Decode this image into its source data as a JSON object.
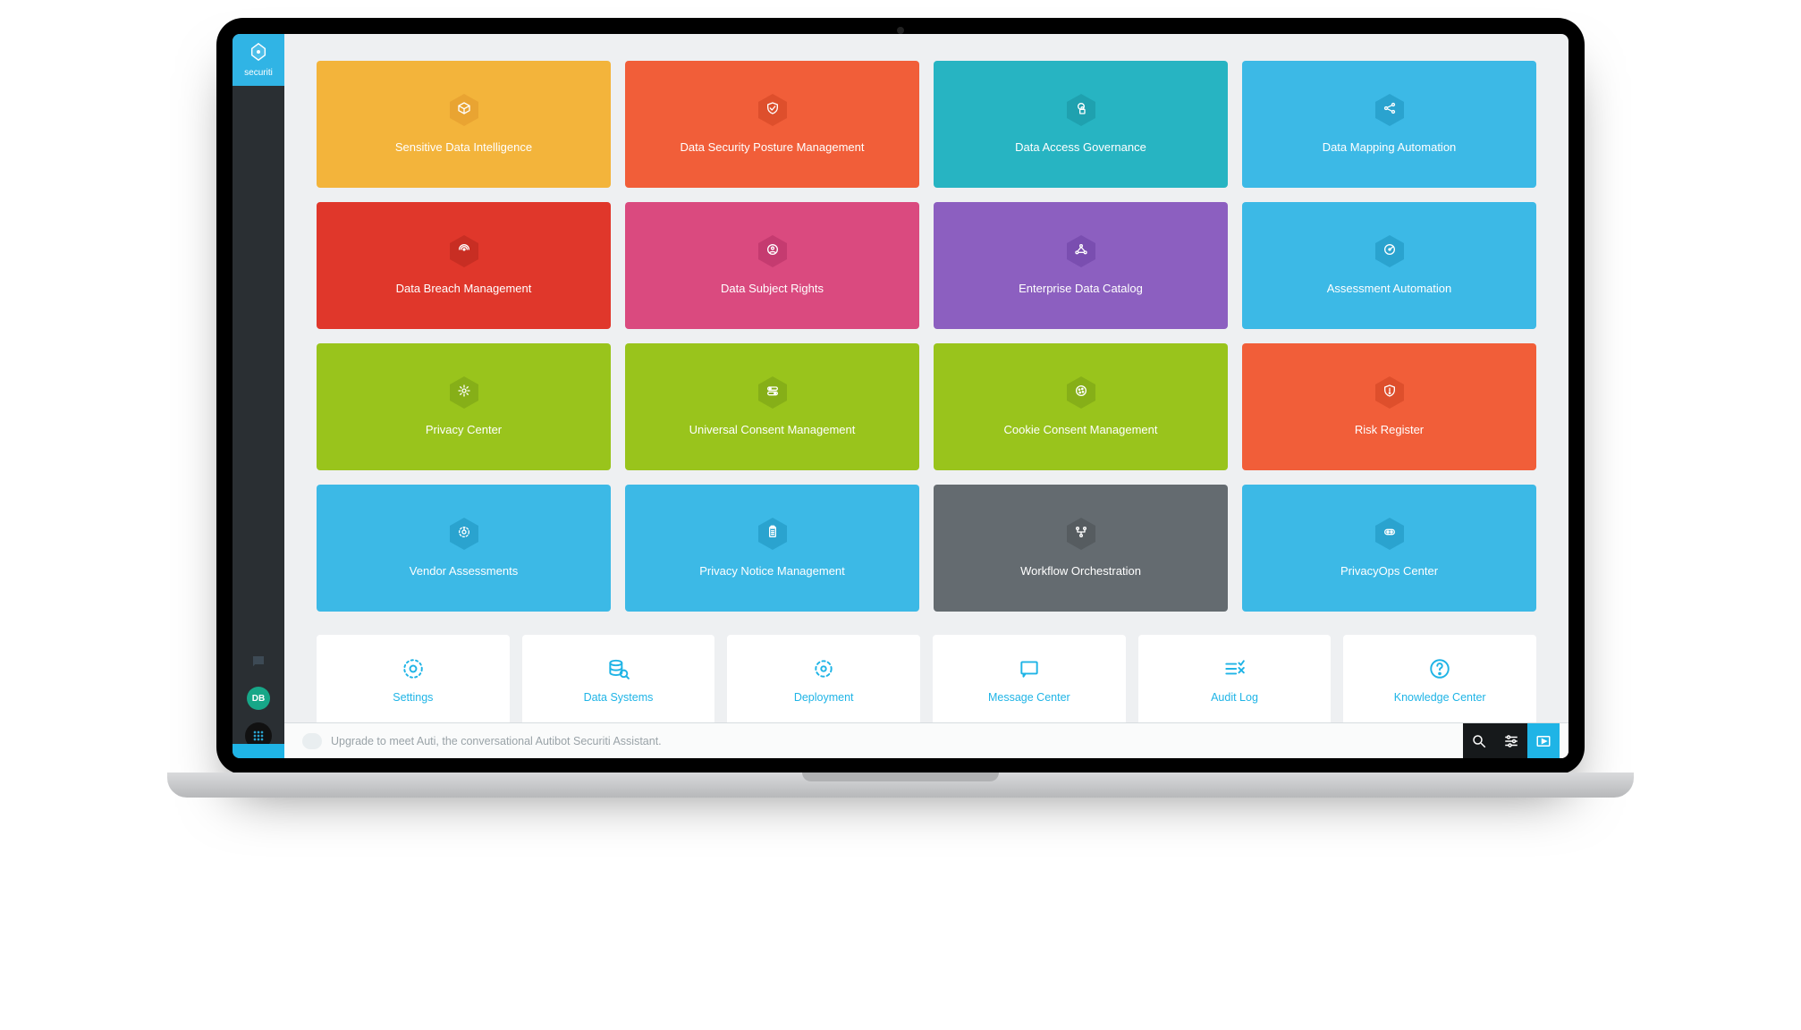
{
  "brand": {
    "name": "securiti",
    "avatar_initials": "DB"
  },
  "tiles": [
    {
      "label": "Sensitive Data Intelligence",
      "color": "#f3b43b",
      "hex": "#e9a432",
      "icon": "cube"
    },
    {
      "label": "Data Security Posture Management",
      "color": "#f15e39",
      "hex": "#de4f2c",
      "icon": "shield"
    },
    {
      "label": "Data Access Governance",
      "color": "#27b4c2",
      "hex": "#1fa1af",
      "icon": "lock"
    },
    {
      "label": "Data Mapping Automation",
      "color": "#3cb9e6",
      "hex": "#2aa3cf",
      "icon": "share"
    },
    {
      "label": "Data Breach Management",
      "color": "#e0372b",
      "hex": "#c82e23",
      "icon": "radar"
    },
    {
      "label": "Data Subject Rights",
      "color": "#da4a7f",
      "hex": "#c53b70",
      "icon": "id"
    },
    {
      "label": "Enterprise Data Catalog",
      "color": "#8c5fc0",
      "hex": "#7a4eb0",
      "icon": "nodes"
    },
    {
      "label": "Assessment Automation",
      "color": "#3cb9e6",
      "hex": "#2aa3cf",
      "icon": "gauge"
    },
    {
      "label": "Privacy Center",
      "color": "#99c41c",
      "hex": "#86af18",
      "icon": "gear"
    },
    {
      "label": "Universal Consent Management",
      "color": "#99c41c",
      "hex": "#86af18",
      "icon": "toggle"
    },
    {
      "label": "Cookie Consent Management",
      "color": "#99c41c",
      "hex": "#86af18",
      "icon": "cookie"
    },
    {
      "label": "Risk Register",
      "color": "#f15e39",
      "hex": "#de4f2c",
      "icon": "alert"
    },
    {
      "label": "Vendor Assessments",
      "color": "#3cb9e6",
      "hex": "#2aa3cf",
      "icon": "dial"
    },
    {
      "label": "Privacy Notice Management",
      "color": "#3cb9e6",
      "hex": "#2aa3cf",
      "icon": "clipboard"
    },
    {
      "label": "Workflow Orchestration",
      "color": "#646b70",
      "hex": "#565c60",
      "icon": "flow"
    },
    {
      "label": "PrivacyOps Center",
      "color": "#3cb9e6",
      "hex": "#2aa3cf",
      "icon": "eyes"
    }
  ],
  "secondary": [
    {
      "label": "Settings",
      "icon": "settings"
    },
    {
      "label": "Data Systems",
      "icon": "db"
    },
    {
      "label": "Deployment",
      "icon": "deploy"
    },
    {
      "label": "Message Center",
      "icon": "message"
    },
    {
      "label": "Audit Log",
      "icon": "audit"
    },
    {
      "label": "Knowledge Center",
      "icon": "help"
    }
  ],
  "footer": {
    "message": "Upgrade to meet Auti, the conversational Autibot Securiti Assistant."
  }
}
